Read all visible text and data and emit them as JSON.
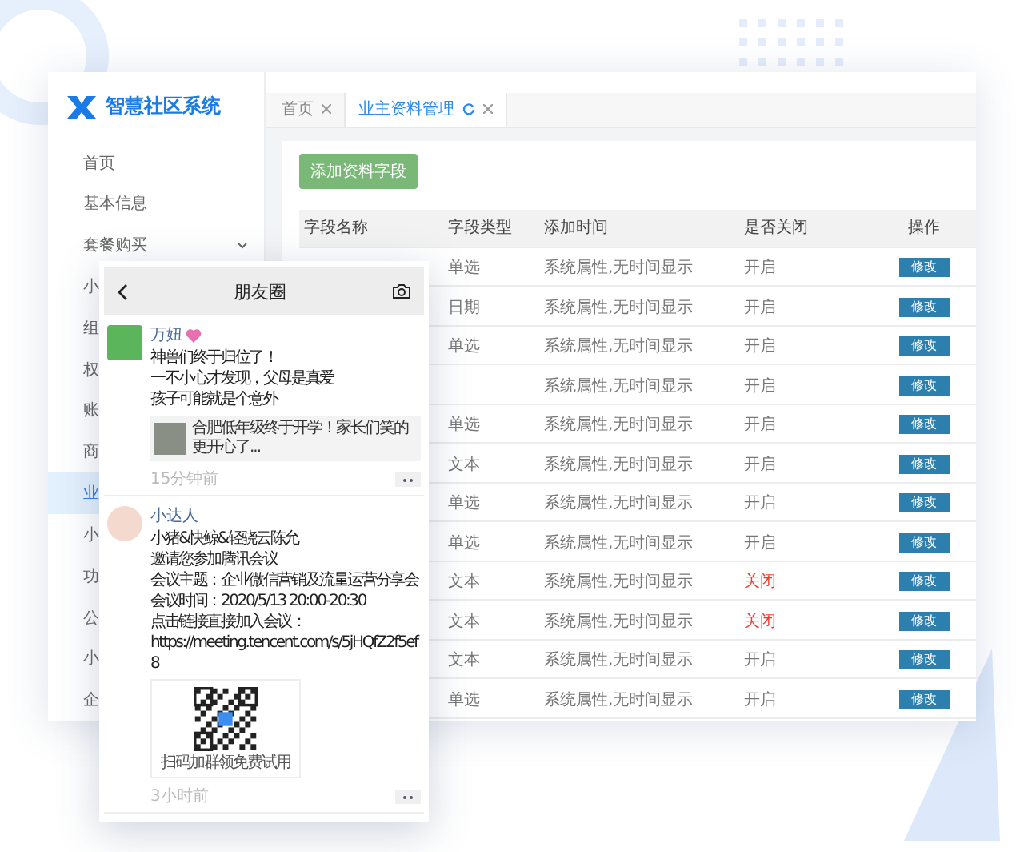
{
  "brand": {
    "name": "智慧社区系统"
  },
  "sidebar": {
    "items": [
      {
        "label": "首页",
        "selected": false,
        "has_children": false
      },
      {
        "label": "基本信息",
        "selected": false,
        "has_children": false
      },
      {
        "label": "套餐购买",
        "selected": false,
        "has_children": true
      },
      {
        "label": "小",
        "selected": false
      },
      {
        "label": "组",
        "selected": false
      },
      {
        "label": "权",
        "selected": false
      },
      {
        "label": "账",
        "selected": false
      },
      {
        "label": "商",
        "selected": false
      },
      {
        "label": "业",
        "selected": true
      },
      {
        "label": "小",
        "selected": false
      },
      {
        "label": "功",
        "selected": false
      },
      {
        "label": "公",
        "selected": false
      },
      {
        "label": "小",
        "selected": false
      },
      {
        "label": "企",
        "selected": false
      }
    ]
  },
  "tabs": [
    {
      "label": "首页",
      "selected": false
    },
    {
      "label": "业主资料管理",
      "selected": true
    }
  ],
  "add_button": "添加资料字段",
  "table": {
    "columns": [
      "字段名称",
      "字段类型",
      "添加时间",
      "是否关闭",
      "操作"
    ],
    "rows": [
      {
        "type": "单选",
        "added": "系统属性,无时间显示",
        "status": "开启",
        "closed": false,
        "action": "修改"
      },
      {
        "type": "日期",
        "added": "系统属性,无时间显示",
        "status": "开启",
        "closed": false,
        "action": "修改"
      },
      {
        "type": "单选",
        "added": "系统属性,无时间显示",
        "status": "开启",
        "closed": false,
        "action": "修改"
      },
      {
        "added": "系统属性,无时间显示",
        "status": "开启",
        "closed": false,
        "action": "修改"
      },
      {
        "type": "单选",
        "added": "系统属性,无时间显示",
        "status": "开启",
        "closed": false,
        "action": "修改"
      },
      {
        "type": "文本",
        "added": "系统属性,无时间显示",
        "status": "开启",
        "closed": false,
        "action": "修改"
      },
      {
        "type": "单选",
        "added": "系统属性,无时间显示",
        "status": "开启",
        "closed": false,
        "action": "修改"
      },
      {
        "type": "单选",
        "added": "系统属性,无时间显示",
        "status": "开启",
        "closed": false,
        "action": "修改"
      },
      {
        "type": "文本",
        "added": "系统属性,无时间显示",
        "status": "关闭",
        "closed": true,
        "action": "修改"
      },
      {
        "type": "文本",
        "added": "系统属性,无时间显示",
        "status": "关闭",
        "closed": true,
        "action": "修改"
      },
      {
        "type": "文本",
        "added": "系统属性,无时间显示",
        "status": "开启",
        "closed": false,
        "action": "修改"
      },
      {
        "type": "单选",
        "added": "系统属性,无时间显示",
        "status": "开启",
        "closed": false,
        "action": "修改"
      }
    ]
  },
  "moments": {
    "title": "朋友圈",
    "posts": [
      {
        "author": "万妞",
        "lines": [
          "神兽们终于归位了！",
          "一不小心才发现，父母是真爱",
          "孩子可能就是个意外"
        ],
        "link": "合肥低年级终于开学！家长们笑的更开心了...",
        "time": "15分钟前"
      },
      {
        "author": "小达人",
        "lines": [
          "小猪&快鲸&轻骁云陈允",
          "邀请您参加腾讯会议",
          "会议主题：企业微信营销及流量运营分享会",
          "会议时间：2020/5/13 20:00-20:30",
          "点击链接直接加入会议：",
          "https://meeting.tencent.com/s/5jHQfZ2f5ef8"
        ],
        "qr_caption": "扫码加群领免费试用",
        "time": "3小时前"
      }
    ]
  }
}
